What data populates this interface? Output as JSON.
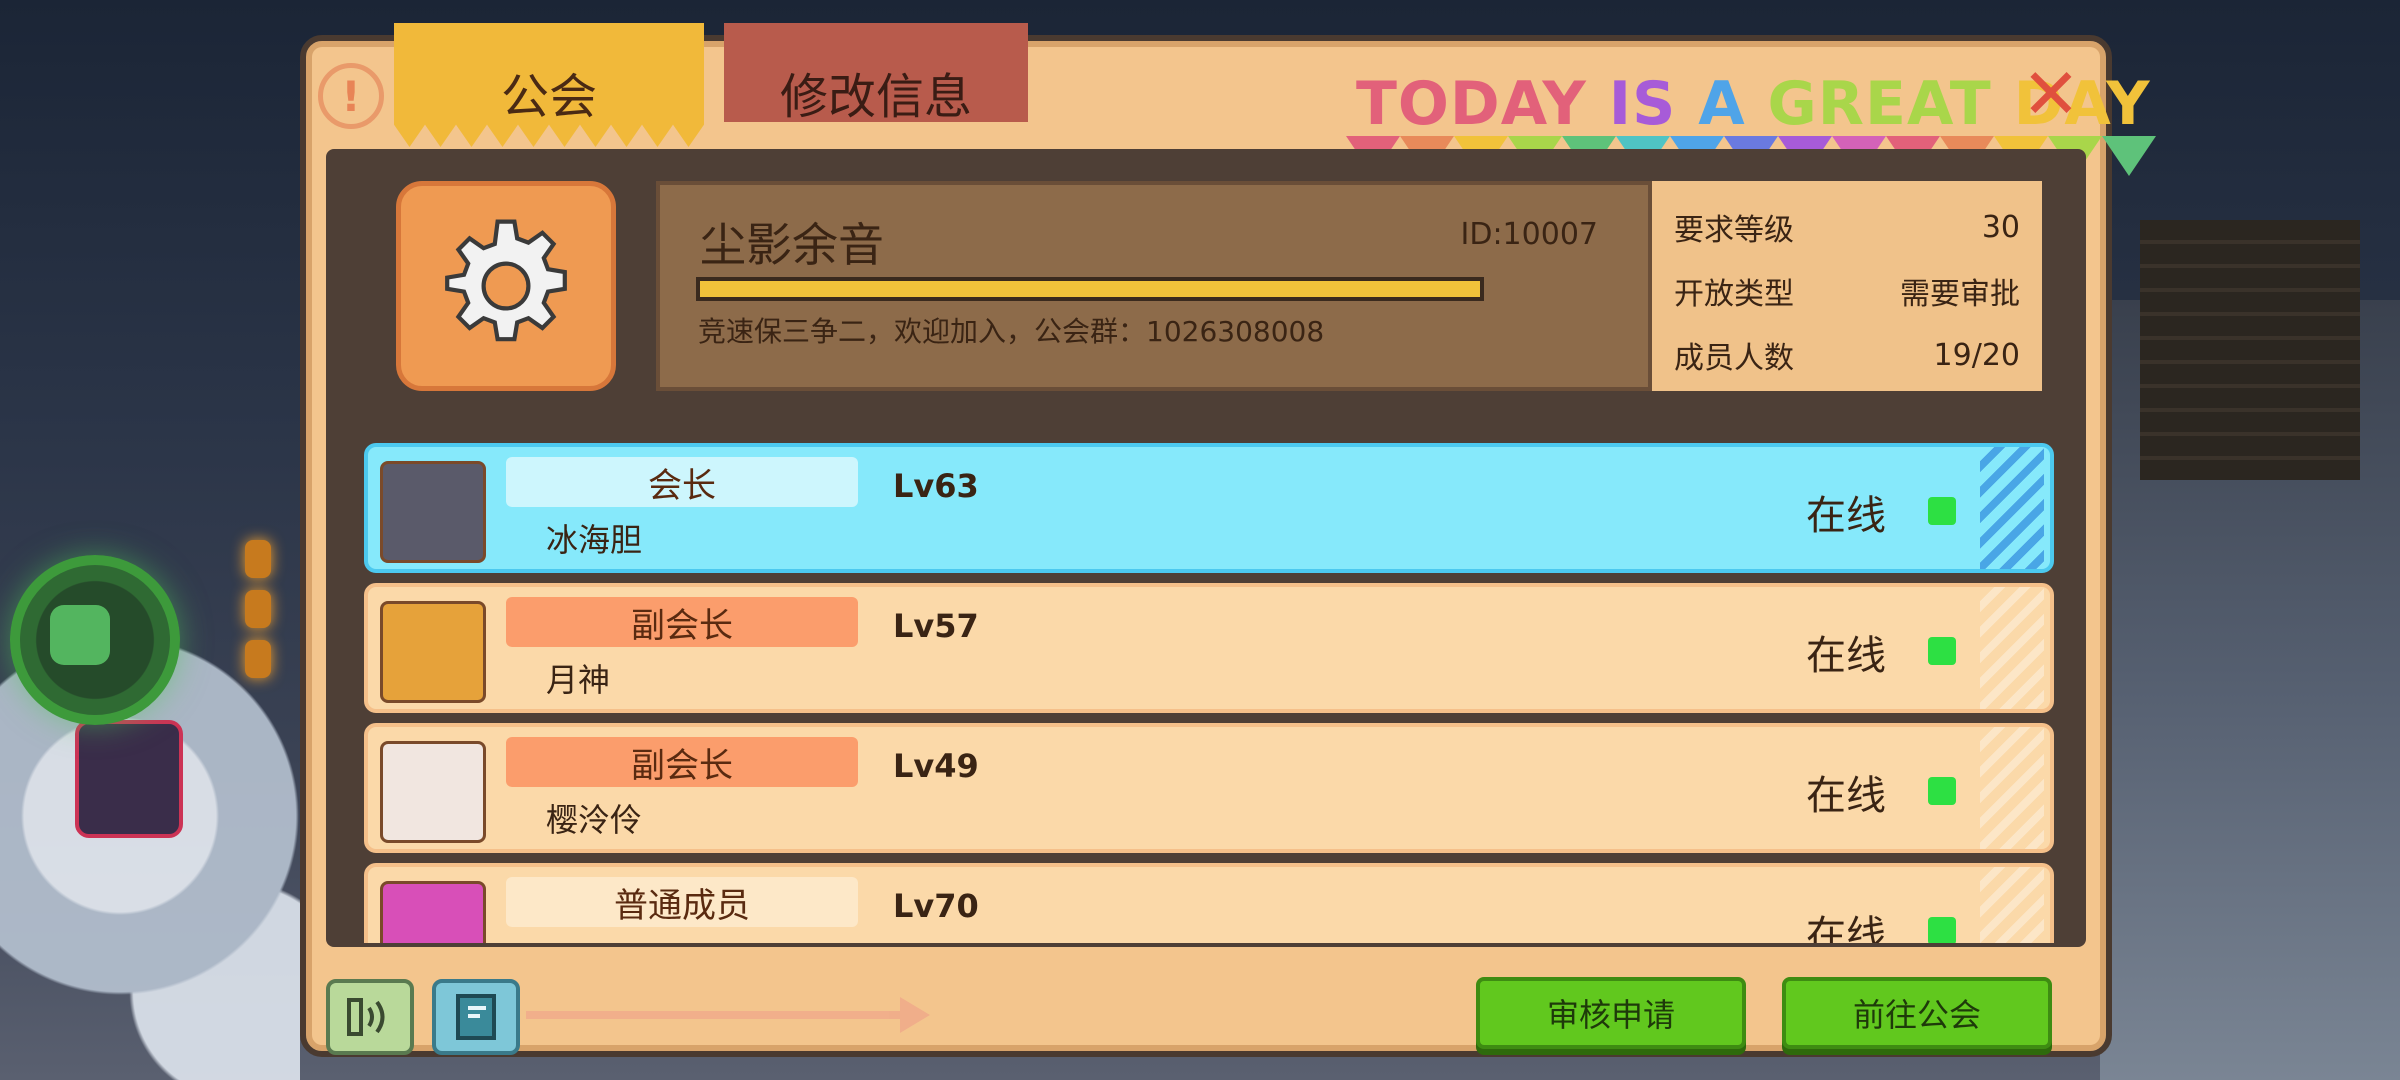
{
  "colors": {
    "dialog_bg": "#f3c58d",
    "tab_active": "#f1b93a",
    "tab_inactive": "#b85b4c",
    "leader_row": "#86e9fb",
    "member_row": "#fbd9a9",
    "role_vice": "#fb9d6c",
    "role_leader": "#cdf6fd",
    "role_normal": "#fde8c8",
    "online_dot": "#2de043",
    "button_green": "#61c81e"
  },
  "tabs": {
    "guild": "公会",
    "edit_info": "修改信息"
  },
  "banner": {
    "words": [
      {
        "text": "TODAY",
        "color": "#e2617a"
      },
      {
        "text": "IS",
        "color": "#a75bd8"
      },
      {
        "text": "A",
        "color": "#4fa4e8"
      },
      {
        "text": "GREAT",
        "color": "#a9d64a"
      },
      {
        "text": "DAY",
        "color": "#f1c23a"
      }
    ]
  },
  "icons": {
    "help": "exclamation-icon",
    "close": "close-icon",
    "emblem": "gear-icon",
    "voice": "speaker-icon",
    "book": "book-icon"
  },
  "help_glyph": "!",
  "close_glyph": "✕",
  "guild": {
    "name": "尘影余音",
    "id": "ID:10007",
    "progress": 1.0,
    "description": "竞速保三争二，欢迎加入，公会群：1026308008"
  },
  "requirements": [
    {
      "label": "要求等级",
      "value": "30"
    },
    {
      "label": "开放类型",
      "value": "需要审批"
    },
    {
      "label": "成员人数",
      "value": "19/20"
    }
  ],
  "members": [
    {
      "role": "会长",
      "name": "冰海胆",
      "level": "Lv63",
      "status": "在线",
      "type": "leader"
    },
    {
      "role": "副会长",
      "name": "月神",
      "level": "Lv57",
      "status": "在线",
      "type": "vice"
    },
    {
      "role": "副会长",
      "name": "樱泠伶",
      "level": "Lv49",
      "status": "在线",
      "type": "vice"
    },
    {
      "role": "普通成员",
      "name": "",
      "level": "Lv70",
      "status": "在线",
      "type": "normal"
    }
  ],
  "footer": {
    "review_button": "审核申请",
    "goto_button": "前往公会"
  }
}
